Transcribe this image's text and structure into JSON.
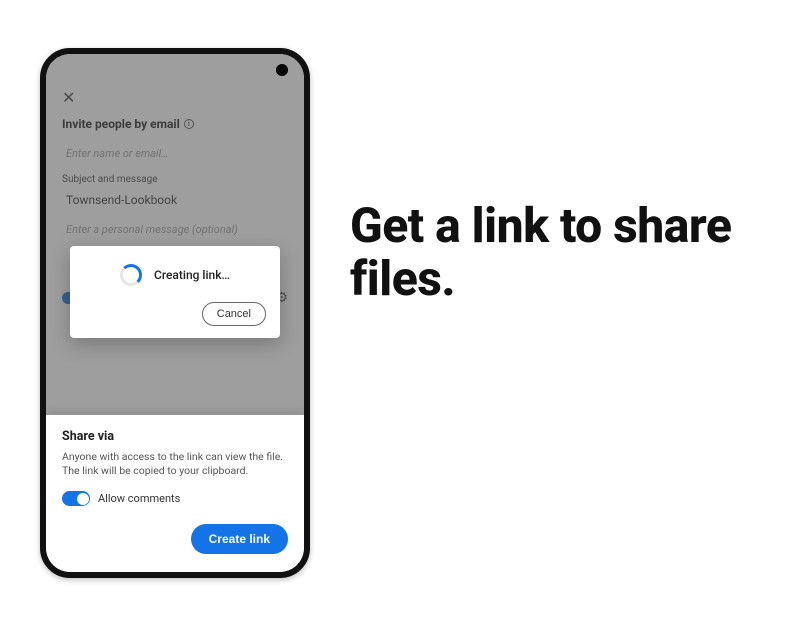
{
  "headline": "Get a link to share files.",
  "screen": {
    "invite_heading": "Invite people by email",
    "name_placeholder": "Enter name or email…",
    "subject_label": "Subject and message",
    "subject_value": "Townsend-Lookbook",
    "message_placeholder": "Enter a personal message (optional)"
  },
  "modal": {
    "status": "Creating link…",
    "cancel": "Cancel"
  },
  "sheet": {
    "title": "Share via",
    "description": "Anyone with access to the link can view the file. The link will be copied to your clipboard.",
    "allow_comments": "Allow comments",
    "create": "Create link"
  }
}
